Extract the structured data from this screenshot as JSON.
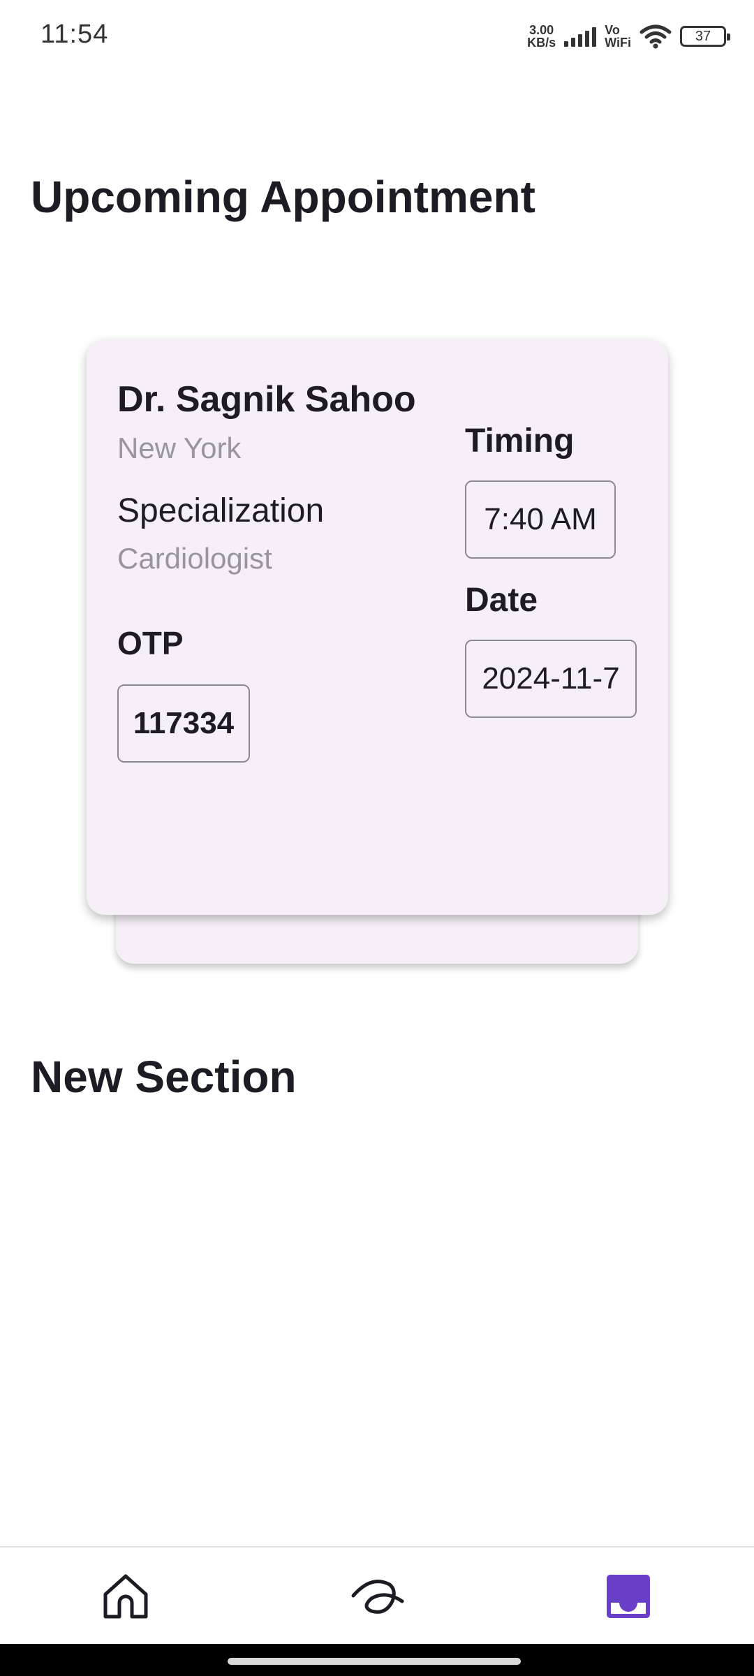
{
  "status_bar": {
    "time": "11:54",
    "net_speed_value": "3.00",
    "net_speed_unit": "KB/s",
    "vowifi_top": "Vo",
    "vowifi_bottom": "WiFi",
    "battery": "37",
    "icons": [
      "signal-icon",
      "wifi-icon",
      "battery-icon"
    ]
  },
  "header": {
    "title": "Upcoming Appointment"
  },
  "appointment": {
    "doctor_name": "Dr. Sagnik Sahoo",
    "city": "New York",
    "specialization_label": "Specialization",
    "specialization": "Cardiologist",
    "otp_label": "OTP",
    "otp": "117334",
    "timing_label": "Timing",
    "timing": "7:40 AM",
    "date_label": "Date",
    "date": "2024-11-7"
  },
  "new_section": {
    "title": "New Section"
  },
  "bottom_nav": {
    "items": [
      {
        "icon": "home-icon",
        "active": false
      },
      {
        "icon": "scribble-icon",
        "active": false
      },
      {
        "icon": "inbox-icon",
        "active": true
      }
    ],
    "active_color": "#6a3fc8"
  }
}
